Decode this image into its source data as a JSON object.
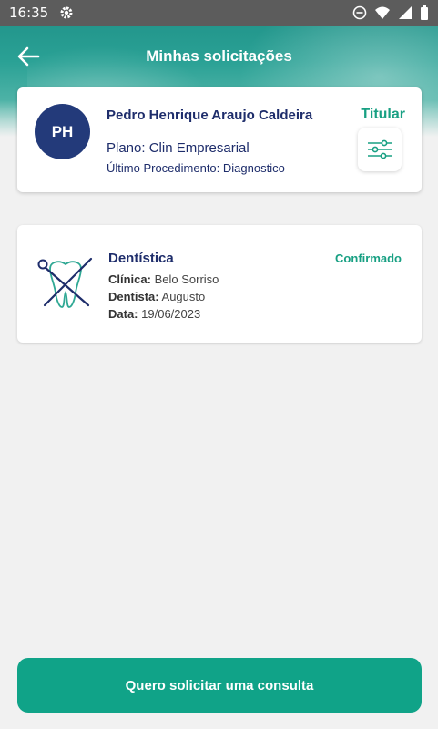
{
  "status_bar": {
    "time": "16:35"
  },
  "app_bar": {
    "title": "Minhas solicitações"
  },
  "profile": {
    "initials": "PH",
    "name": "Pedro Henrique Araujo Caldeira",
    "badge": "Titular",
    "plan": "Plano: Clin Empresarial",
    "last_procedure": "Último Procedimento: Diagnostico"
  },
  "requests": [
    {
      "title": "Dentística",
      "status": "Confirmado",
      "clinic_label": "Clínica:",
      "clinic_value": "Belo Sorriso",
      "dentist_label": "Dentista:",
      "dentist_value": "Augusto",
      "date_label": "Data:",
      "date_value": "19/06/2023"
    }
  ],
  "cta": {
    "label": "Quero solicitar uma consulta"
  },
  "colors": {
    "accent": "#10a388",
    "navy": "#1e2d6b",
    "avatar": "#233a7a"
  }
}
